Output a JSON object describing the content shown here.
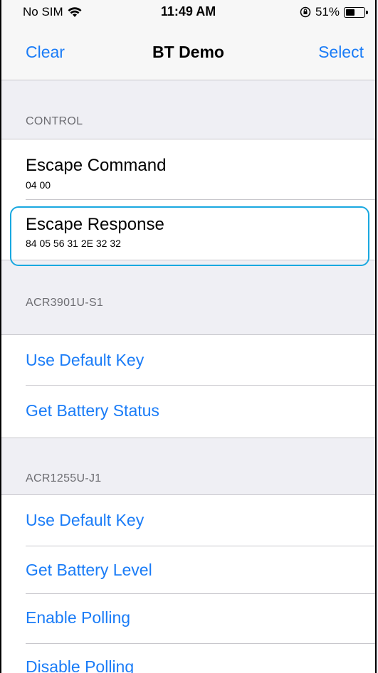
{
  "status_bar": {
    "carrier": "No SIM",
    "time": "11:49 AM",
    "battery_percent": "51%",
    "battery_level": 0.51
  },
  "nav": {
    "left_button": "Clear",
    "title": "BT Demo",
    "right_button": "Select"
  },
  "control": {
    "header": "CONTROL",
    "escape_command": {
      "title": "Escape Command",
      "value": "04 00"
    },
    "escape_response": {
      "title": "Escape Response",
      "value": "84 05 56 31 2E 32 32"
    }
  },
  "acr3901": {
    "header": "ACR3901U-S1",
    "items": [
      "Use Default Key",
      "Get Battery Status"
    ]
  },
  "acr1255": {
    "header": "ACR1255U-J1",
    "items": [
      "Use Default Key",
      "Get Battery Level",
      "Enable Polling",
      "Disable Polling"
    ]
  },
  "colors": {
    "accent": "#1a7cf7",
    "highlight": "#19a8e0",
    "background": "#efeff4"
  }
}
